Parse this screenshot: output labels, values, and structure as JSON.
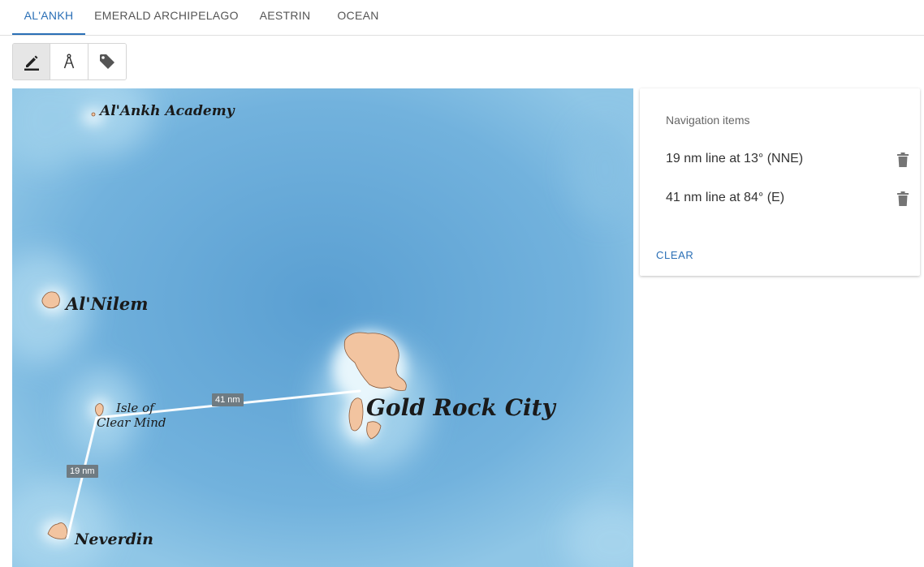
{
  "tabs": [
    {
      "label": "AL'ANKH",
      "active": true
    },
    {
      "label": "EMERALD ARCHIPELAGO",
      "active": false
    },
    {
      "label": "AESTRIN",
      "active": false
    },
    {
      "label": "OCEAN",
      "active": false
    }
  ],
  "toolbar": {
    "tools": [
      {
        "icon": "pencil-icon",
        "active": true
      },
      {
        "icon": "compass-icon",
        "active": false
      },
      {
        "icon": "tag-icon",
        "active": false
      }
    ]
  },
  "map": {
    "labels": {
      "academy": "Al'Ankh Academy",
      "nilem": "Al'Nilem",
      "isle_line1": "Isle of",
      "isle_line2": "Clear Mind",
      "gold_rock": "Gold Rock City",
      "neverdin": "Neverdin"
    },
    "distances": {
      "line_41": "41 nm",
      "line_19": "19 nm"
    },
    "colors": {
      "water": "#6fb0dc",
      "shallow": "#bfe3f3",
      "land": "#f2c4a0",
      "route": "#ffffff"
    }
  },
  "panel": {
    "title": "Navigation items",
    "items": [
      {
        "text": "19 nm line at 13° (NNE)"
      },
      {
        "text": "41 nm line at 84° (E)"
      }
    ],
    "clear_label": "CLEAR"
  }
}
